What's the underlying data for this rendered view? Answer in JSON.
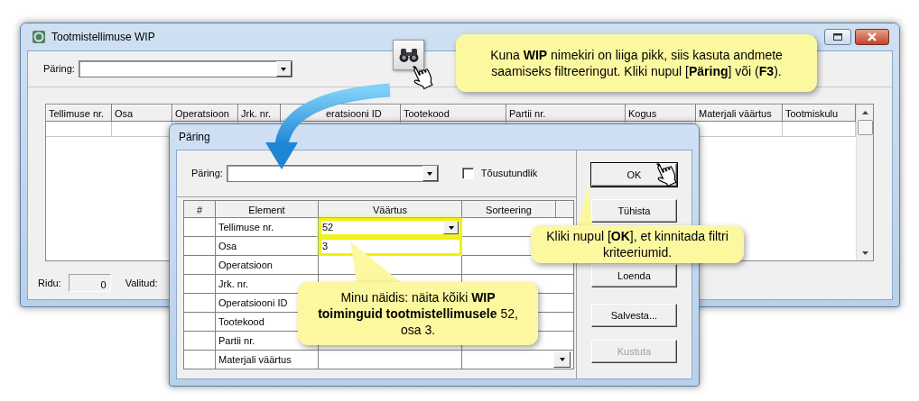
{
  "main_window": {
    "title": "Tootmistellimuse WIP",
    "query_label": "Päring:",
    "table": {
      "columns": [
        "Tellimuse nr.",
        "Osa",
        "Operatsioon",
        "Jrk. nr.",
        "eratsiooni ID",
        "Tootekood",
        "Partii nr.",
        "Kogus",
        "Materjali väärtus",
        "Tootmiskulu"
      ]
    },
    "status_bar": {
      "rows_label": "Ridu:",
      "rows_value": "0",
      "selected_label": "Valitud:"
    }
  },
  "dialog": {
    "title": "Päring",
    "query_label": "Päring:",
    "ascending": {
      "label": "Tõusutundlik",
      "checked": false
    },
    "grid": {
      "columns": [
        "#",
        "Element",
        "Väärtus",
        "Sorteering"
      ],
      "rows": [
        {
          "element": "Tellimuse nr.",
          "value": "52",
          "highlighted": true,
          "value_dropdown": true,
          "sort_dropdown": false
        },
        {
          "element": "Osa",
          "value": "3",
          "highlighted": true,
          "value_dropdown": false,
          "sort_dropdown": false
        },
        {
          "element": "Operatsioon",
          "highlighted": false,
          "value_dropdown": false,
          "sort_dropdown": false
        },
        {
          "element": "Jrk. nr.",
          "highlighted": false,
          "value_dropdown": false,
          "sort_dropdown": false
        },
        {
          "element": "Operatsiooni ID",
          "sort_dropdown": false
        },
        {
          "element": "Tootekood",
          "sort_dropdown": false
        },
        {
          "element": "Partii nr.",
          "highlighted": false,
          "value_dropdown": false,
          "sort_dropdown": false
        },
        {
          "element": "Materjali väärtus",
          "highlighted": false,
          "value_dropdown": false,
          "sort_dropdown": true
        }
      ]
    },
    "buttons": [
      {
        "label": "OK",
        "default": true,
        "disabled": false
      },
      {
        "label": "Tühista",
        "default": false,
        "disabled": false
      },
      {
        "label": "Loenda",
        "default": false,
        "disabled": false
      },
      {
        "label": "Salvesta...",
        "default": false,
        "disabled": false
      },
      {
        "label": "Kustuta",
        "default": false,
        "disabled": true
      }
    ]
  },
  "callouts": [
    {
      "text": "Kuna **WIP** nimekiri on liiga pikk, siis kasuta andmete saamiseks filtreeringut. Kliki nupul  [**Päring**] või (**F3**)."
    },
    {
      "text": "Kliki nupul [**OK**], et kinnitada filtri kriteeriumid."
    },
    {
      "text": "Minu näidis: näita kõiki **WIP toiminguid tootmistellimusele** 52, osa 3."
    }
  ]
}
